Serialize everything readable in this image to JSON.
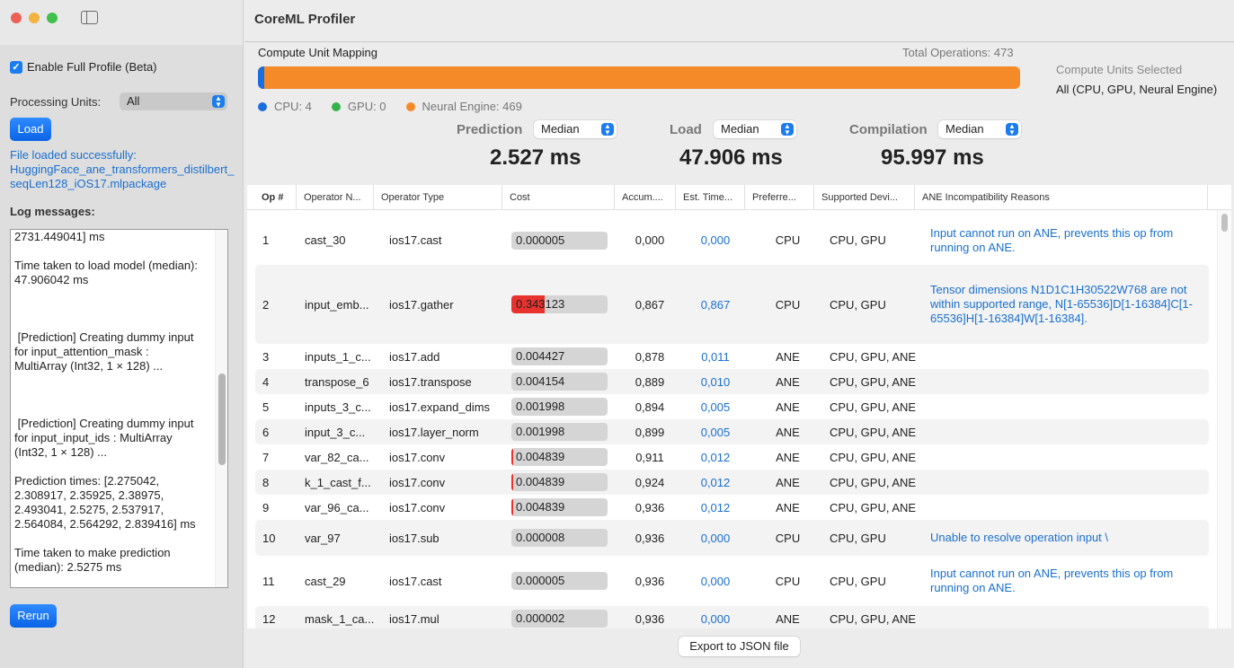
{
  "window": {
    "title": "CoreML Profiler"
  },
  "sidebar": {
    "enable_full_profile": {
      "label": "Enable Full Profile (Beta)",
      "checked": true
    },
    "processing_units": {
      "label": "Processing Units:",
      "value": "All"
    },
    "load_label": "Load",
    "status_line1": "File loaded successfully:",
    "status_line2": "HuggingFace_ane_transformers_distilbert_seqLen128_iOS17.mlpackage",
    "log_label": "Log messages:",
    "log_text": "2731.449041] ms\n\nTime taken to load model (median):\n47.906042 ms\n\n\n\n [Prediction] Creating dummy input\nfor input_attention_mask :\nMultiArray (Int32, 1 × 128) ...\n\n\n\n [Prediction] Creating dummy input\nfor input_input_ids : MultiArray\n(Int32, 1 × 128) ...\n\nPrediction times: [2.275042,\n2.308917, 2.35925, 2.38975,\n2.493041, 2.5275, 2.537917,\n2.564084, 2.564292, 2.839416] ms\n\nTime taken to make prediction\n(median): 2.5275 ms",
    "rerun_label": "Rerun"
  },
  "mapping": {
    "title": "Compute Unit Mapping",
    "total_ops": "Total Operations: 473",
    "cpu_count": 4,
    "gpu_count": 0,
    "ane_count": 469,
    "total": 473,
    "legend": {
      "cpu": "CPU: 4",
      "gpu": "GPU: 0",
      "ane": "Neural Engine: 469"
    },
    "colors": {
      "cpu": "#1a6fe0",
      "gpu": "#33b34a",
      "ane": "#f58a29"
    }
  },
  "compute_units": {
    "label": "Compute Units Selected",
    "value": "All (CPU, GPU, Neural Engine)"
  },
  "metrics": {
    "prediction": {
      "label": "Prediction",
      "mode": "Median",
      "value": "2.527 ms"
    },
    "load": {
      "label": "Load",
      "mode": "Median",
      "value": "47.906 ms"
    },
    "compilation": {
      "label": "Compilation",
      "mode": "Median",
      "value": "95.997 ms"
    }
  },
  "table": {
    "headers": [
      "Op #",
      "Operator N...",
      "Operator Type",
      "Cost",
      "Accum....",
      "Est. Time...",
      "Preferre...",
      "Supported Devi...",
      "ANE Incompatibility Reasons"
    ],
    "rows": [
      {
        "op": "1",
        "name": "cast_30",
        "type": "ios17.cast",
        "cost": "0.000005",
        "cost_val": 5e-06,
        "accum": "0,000",
        "est": "0,000",
        "pref": "CPU",
        "sup": "CPU, GPU",
        "reason": "Input cannot run on ANE, prevents this op from running on ANE."
      },
      {
        "op": "2",
        "name": "input_emb...",
        "type": "ios17.gather",
        "cost": "0.343123",
        "cost_val": 0.343123,
        "accum": "0,867",
        "est": "0,867",
        "pref": "CPU",
        "sup": "CPU, GPU",
        "reason": "Tensor dimensions N1D1C1H30522W768 are not within supported range, N[1-65536]D[1-16384]C[1-65536]H[1-16384]W[1-16384]."
      },
      {
        "op": "3",
        "name": "inputs_1_c...",
        "type": "ios17.add",
        "cost": "0.004427",
        "cost_val": 0.004427,
        "accum": "0,878",
        "est": "0,011",
        "pref": "ANE",
        "sup": "CPU, GPU, ANE",
        "reason": ""
      },
      {
        "op": "4",
        "name": "transpose_6",
        "type": "ios17.transpose",
        "cost": "0.004154",
        "cost_val": 0.004154,
        "accum": "0,889",
        "est": "0,010",
        "pref": "ANE",
        "sup": "CPU, GPU, ANE",
        "reason": ""
      },
      {
        "op": "5",
        "name": "inputs_3_c...",
        "type": "ios17.expand_dims",
        "cost": "0.001998",
        "cost_val": 0.001998,
        "accum": "0,894",
        "est": "0,005",
        "pref": "ANE",
        "sup": "CPU, GPU, ANE",
        "reason": ""
      },
      {
        "op": "6",
        "name": "input_3_c...",
        "type": "ios17.layer_norm",
        "cost": "0.001998",
        "cost_val": 0.001998,
        "accum": "0,899",
        "est": "0,005",
        "pref": "ANE",
        "sup": "CPU, GPU, ANE",
        "reason": ""
      },
      {
        "op": "7",
        "name": "var_82_ca...",
        "type": "ios17.conv",
        "cost": "0.004839",
        "cost_val": 0.004839,
        "accum": "0,911",
        "est": "0,012",
        "pref": "ANE",
        "sup": "CPU, GPU, ANE",
        "reason": ""
      },
      {
        "op": "8",
        "name": "k_1_cast_f...",
        "type": "ios17.conv",
        "cost": "0.004839",
        "cost_val": 0.004839,
        "accum": "0,924",
        "est": "0,012",
        "pref": "ANE",
        "sup": "CPU, GPU, ANE",
        "reason": ""
      },
      {
        "op": "9",
        "name": "var_96_ca...",
        "type": "ios17.conv",
        "cost": "0.004839",
        "cost_val": 0.004839,
        "accum": "0,936",
        "est": "0,012",
        "pref": "ANE",
        "sup": "CPU, GPU, ANE",
        "reason": ""
      },
      {
        "op": "10",
        "name": "var_97",
        "type": "ios17.sub",
        "cost": "0.000008",
        "cost_val": 8e-06,
        "accum": "0,936",
        "est": "0,000",
        "pref": "CPU",
        "sup": "CPU, GPU",
        "reason": "Unable to resolve operation input \\"
      },
      {
        "op": "11",
        "name": "cast_29",
        "type": "ios17.cast",
        "cost": "0.000005",
        "cost_val": 5e-06,
        "accum": "0,936",
        "est": "0,000",
        "pref": "CPU",
        "sup": "CPU, GPU",
        "reason": "Input cannot run on ANE, prevents this op from running on ANE."
      },
      {
        "op": "12",
        "name": "mask_1_ca...",
        "type": "ios17.mul",
        "cost": "0.000002",
        "cost_val": 2e-06,
        "accum": "0,936",
        "est": "0,000",
        "pref": "ANE",
        "sup": "CPU, GPU, ANE",
        "reason": ""
      }
    ]
  },
  "footer": {
    "export_label": "Export to JSON file"
  }
}
